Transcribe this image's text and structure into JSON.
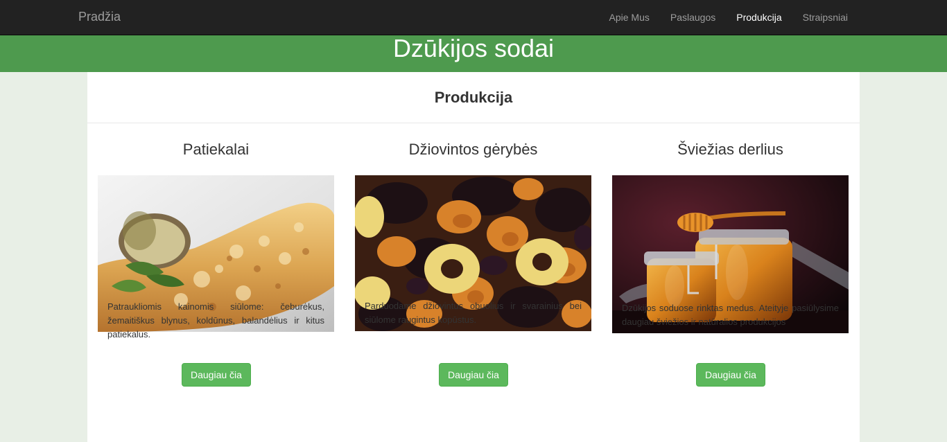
{
  "navbar": {
    "brand": "Pradžia",
    "links": [
      {
        "label": "Apie Mus",
        "active": false
      },
      {
        "label": "Paslaugos",
        "active": false
      },
      {
        "label": "Produkcija",
        "active": true
      },
      {
        "label": "Straipsniai",
        "active": false
      }
    ]
  },
  "banner": {
    "title": "Dzūkijos sodai"
  },
  "page": {
    "heading": "Produkcija"
  },
  "products": [
    {
      "title": "Patiekalai",
      "image": "pancake-photo",
      "description": "Patraukliomis kainomis siūlome: čeburėkus, žemaitiškus blynus, koldūnus, balandėlius ir kitus patiekalus.",
      "button": "Daugiau čia"
    },
    {
      "title": "Džiovintos gėrybės",
      "image": "dried-fruit-photo",
      "description": "Parduodame džiovintus obuolius ir svarainius bei siūlome raugintus kopūstus.",
      "button": "Daugiau čia"
    },
    {
      "title": "Šviežias derlius",
      "image": "honey-jar-photo",
      "description": "Dzūkijos soduose rinktas medus. Ateityje pasiūlysime daugiau šviežios ir natūralios produkcijos",
      "button": "Daugiau čia"
    }
  ],
  "colors": {
    "navbar": "#222222",
    "banner": "#4e9a4e",
    "button": "#5cb85c",
    "background": "#e8efe6"
  }
}
